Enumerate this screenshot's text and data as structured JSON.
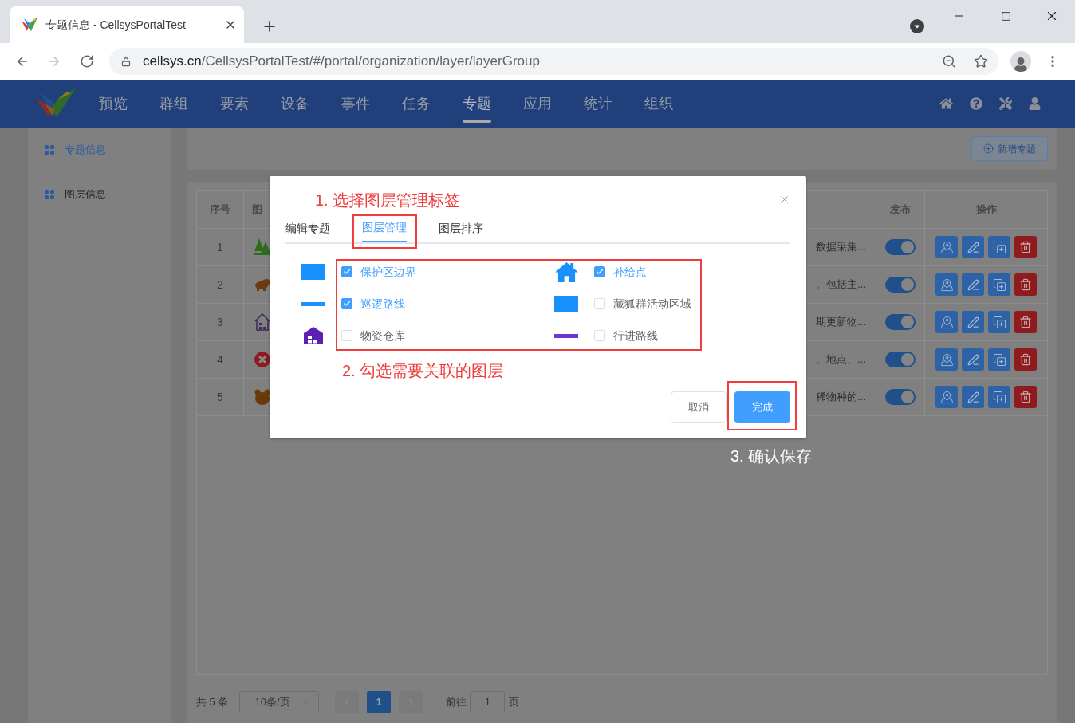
{
  "browser": {
    "tab_title": "专题信息 - CellsysPortalTest",
    "url": {
      "host": "cellsys.cn",
      "path": "/CellsysPortalTest/#/portal/organization/layer/layerGroup"
    }
  },
  "nav": {
    "items": [
      {
        "label": "预览",
        "selected": false
      },
      {
        "label": "群组",
        "selected": false
      },
      {
        "label": "要素",
        "selected": false
      },
      {
        "label": "设备",
        "selected": false
      },
      {
        "label": "事件",
        "selected": false
      },
      {
        "label": "任务",
        "selected": false
      },
      {
        "label": "专题",
        "selected": true
      },
      {
        "label": "应用",
        "selected": false
      },
      {
        "label": "统计",
        "selected": false
      },
      {
        "label": "组织",
        "selected": false
      }
    ]
  },
  "sidebar": {
    "items": [
      {
        "label": "专题信息",
        "selected": true
      },
      {
        "label": "图层信息",
        "selected": false
      }
    ]
  },
  "toolbar": {
    "new_button": "新增专题"
  },
  "table": {
    "columns": [
      "序号",
      "图",
      "发布",
      "操作"
    ],
    "rows": [
      {
        "index": "1",
        "column_3": "数据采集...",
        "published": true
      },
      {
        "index": "2",
        "column_3": "。包括主...",
        "published": true
      },
      {
        "index": "3",
        "column_3": "期更新物...",
        "published": true
      },
      {
        "index": "4",
        "column_3": "、地点、...",
        "published": true
      },
      {
        "index": "5",
        "column_3": "稀物种的...",
        "published": true
      }
    ]
  },
  "pagination": {
    "total": "共 5 条",
    "page_size": "10条/页",
    "prev": {
      "disabled": true
    },
    "pages": [
      {
        "label": "1",
        "selected": true
      }
    ],
    "next": {
      "disabled": true
    },
    "goto": {
      "label": "前往",
      "value": "1",
      "suffix": "页"
    }
  },
  "dialog": {
    "tabs": [
      {
        "label": "编辑专题",
        "selected": false
      },
      {
        "label": "图层管理",
        "selected": true
      },
      {
        "label": "图层排序",
        "selected": false
      }
    ],
    "layers": [
      {
        "name": "保护区边界",
        "kind": "area",
        "color": "#1890ff",
        "checked": true
      },
      {
        "name": "补给点",
        "kind": "house",
        "color": "#1890ff",
        "checked": true
      },
      {
        "name": "巡逻路线",
        "kind": "line",
        "color": "#1890ff",
        "checked": true
      },
      {
        "name": "藏狐群活动区域",
        "kind": "area",
        "color": "#1890ff",
        "checked": false
      },
      {
        "name": "物资仓库",
        "kind": "warehouse",
        "color": "#5b21b6",
        "checked": false
      },
      {
        "name": "行进路线",
        "kind": "line",
        "color": "#6d35cc",
        "checked": false
      }
    ],
    "cancel_button": "取消",
    "confirm_button": "完成"
  },
  "annotations": [
    "1. 选择图层管理标签",
    "2. 勾选需要关联的图层",
    "3. 确认保存"
  ]
}
